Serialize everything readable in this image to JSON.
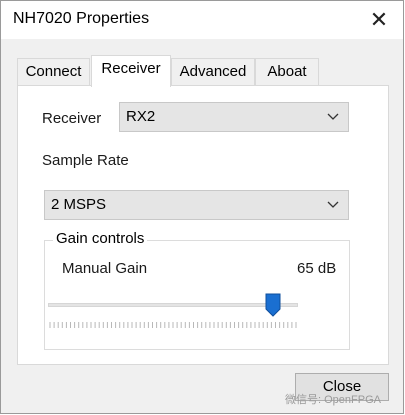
{
  "window": {
    "title": "NH7020 Properties",
    "close_glyph": "✕"
  },
  "tabs": [
    {
      "label": "Connect",
      "active": false
    },
    {
      "label": "Receiver",
      "active": true
    },
    {
      "label": "Advanced",
      "active": false
    },
    {
      "label": "Aboat",
      "active": false
    }
  ],
  "receiver": {
    "label": "Receiver",
    "value": "RX2"
  },
  "sample_rate": {
    "label": "Sample Rate",
    "value": "2 MSPS"
  },
  "gain": {
    "group_title": "Gain controls",
    "label": "Manual Gain",
    "value_text": "65 dB",
    "slider_fraction": 0.9
  },
  "footer": {
    "close_label": "Close"
  },
  "watermark": {
    "text": "微信号: OpenFPGA"
  },
  "colors": {
    "accent": "#1a6fd1",
    "panel_bg": "#ffffff",
    "window_bg": "#f0f0f0"
  }
}
